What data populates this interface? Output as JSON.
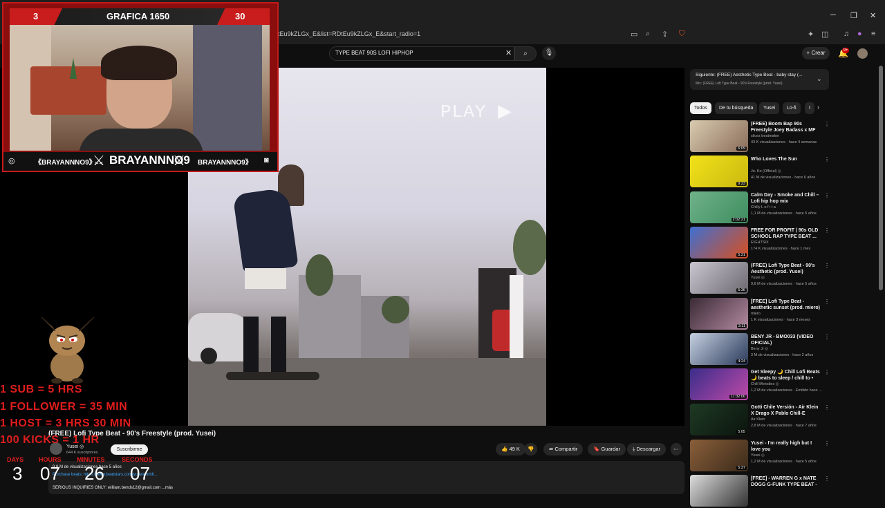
{
  "browser": {
    "url": "tEu9kZLGx_E&list=RDtEu9kZLGx_E&start_radio=1"
  },
  "header": {
    "search_query": "TYPE BEAT 90S LOFI HIPHOP",
    "create_label": "Crear",
    "notification_count": "9+"
  },
  "player": {
    "overlay_text": "PLAY ▶"
  },
  "video": {
    "title": "(FREE) Lofi Type Beat - 90's Freestyle (prod. Yusei)",
    "channel": "Yusei ◎",
    "subscribers": "644 K suscriptores",
    "subscribe_label": "Suscribirme",
    "likes": "49 K",
    "share_label": "Compartir",
    "save_label": "Guardar",
    "download_label": "Descargar",
    "description_views": "9,8 M de visualizaciones  hace 5 años",
    "description_link": "Purchase beats: https://www.beatstars.com/yuseiworld/...",
    "description_contact": "SERIOUS INQUIRIES ONLY: william.bends12@gmail.com  ...más"
  },
  "up_next": {
    "title": "Siguiente: (FREE) Aesthetic Type Beat - baby stay (...",
    "subtitle": "Mix: (FREE) Lofi Type Beat - 90's Freestyle (prod. Yusei)"
  },
  "chips": [
    "Todos",
    "De tu búsqueda",
    "Yusei",
    "Lo-fi",
    "I"
  ],
  "recommendations": [
    {
      "title": "(FREE) Boom Bap 90s Freestyle Joey Badass x MF Doom Type ...",
      "channel": "slicez beatmaker",
      "meta": "43 K visualizaciones · hace 4 semanas",
      "duration": "6:09",
      "c1": "#d9cbb0",
      "c2": "#8a6d5a"
    },
    {
      "title": "Who Loves The Sun",
      "channel": "Jo. Ko (Official) ◎",
      "meta": "41 M de visualizaciones · hace 6 años",
      "duration": "9:23",
      "c1": "#f2e21a",
      "c2": "#c9b80f"
    },
    {
      "title": "Calm Day - Smoke and Chill – Lofi hip hop mix",
      "channel": "Chilly L o f i t a",
      "meta": "1,1 M de visualizaciones · hace 5 años",
      "duration": "2:02:21",
      "c1": "#6fb28a",
      "c2": "#3f8c5f"
    },
    {
      "title": "FREE FOR PROFIT | 90s OLD SCHOOL RAP TYPE BEAT ...",
      "channel": "EIGHTSIX",
      "meta": "174 K visualizaciones · hace 1 mes",
      "duration": "5:21",
      "c1": "#3f6fd1",
      "c2": "#d84f1f"
    },
    {
      "title": "(FREE) Lofi Type Beat - 90's Aesthetic (prod. Yusei)",
      "channel": "Yusei ◎",
      "meta": "9,8 M de visualizaciones · hace 5 años",
      "duration": "5:36",
      "c1": "#c9c6d0",
      "c2": "#6c6870"
    },
    {
      "title": "[FREE] Lofi Type Beat -aesthetic sunset (prod. miero)(free to ...",
      "channel": "miero",
      "meta": "1 K visualizaciones · hace 3 meses",
      "duration": "3:11",
      "c1": "#3a2a36",
      "c2": "#b48aa0"
    },
    {
      "title": "BENY JR - BMO033 (VIDEO OFICIAL)",
      "channel": "Beny Jr ◎",
      "meta": "3 M de visualizaciones · hace 2 años",
      "duration": "4:24",
      "c1": "#c5d0e0",
      "c2": "#2a3a5a"
    },
    {
      "title": "Get Sleepy 🌙 Chill Lofi Beats 🌙 beats to sleep / chill to • lo...",
      "channel": "Chill Melodies ◎",
      "meta": "1,2 M de visualizaciones · Emitido hace ...",
      "duration": "11:32:00",
      "c1": "#3a2d8a",
      "c2": "#c04aa8"
    },
    {
      "title": "Gotti Chile Versión - Air Klein X Drago X Pablo Chill-E",
      "channel": "Air Klein",
      "meta": "2,8 M de visualizaciones · hace 7 años",
      "duration": "5:05",
      "c1": "#1e3a24",
      "c2": "#0b140d"
    },
    {
      "title": "Yusei - I'm really high but I love you",
      "channel": "Yusei ◎",
      "meta": "1,2 M de visualizaciones · hace 5 años",
      "duration": "5:37",
      "c1": "#8a5f3a",
      "c2": "#3a2a1a"
    },
    {
      "title": "[FREE] - WARREN G x NATE DOGG G-FUNK TYPE BEAT - \"S...",
      "channel": "",
      "meta": "",
      "duration": "",
      "c1": "#ddd",
      "c2": "#333"
    }
  ],
  "stream": {
    "goal_left": "3",
    "goal_title": "GRAFICA 1650",
    "goal_right": "30",
    "handle_left": "《BRAYANNNO9》",
    "handle_main": "BRAYANNNO9",
    "handle_right": "BRAYANNNO9》",
    "rules": [
      "1 SUB = 5 HRS",
      "1 FOLLOWER = 35 MIN",
      "1 HOST = 3 HRS 30 MIN",
      "100 KICKS = 1 HR"
    ],
    "timer_labels": [
      "DAYS",
      "HOURS",
      "MINUTES",
      "SECONDS"
    ],
    "timer_values": [
      "3",
      "07",
      "26",
      "07"
    ]
  },
  "colors": {
    "accent_red": "#e01d1d",
    "frame_red": "#c61a1a",
    "yt_bg": "#0f0f0f"
  }
}
